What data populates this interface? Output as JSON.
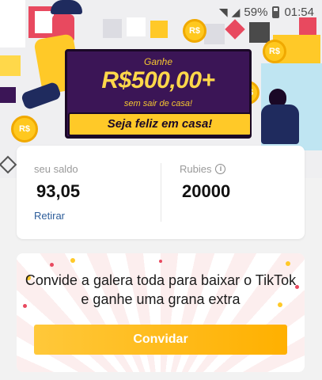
{
  "status_bar": {
    "battery": "59%",
    "time": "01:54"
  },
  "hero": {
    "ganhe": "Ganhe",
    "amount": "R$500,00+",
    "subtitle": "sem sair de casa!",
    "ribbon": "Seja feliz em casa!",
    "coin_label": "R$"
  },
  "balance": {
    "label": "seu saldo",
    "value": "93,05",
    "withdraw": "Retirar"
  },
  "rubies": {
    "label": "Rubies",
    "value": "20000",
    "info_symbol": "i"
  },
  "invite": {
    "text": "Convide a galera toda para baixar o TikTok e ganhe uma grana extra",
    "button": "Convidar"
  },
  "colors": {
    "accent": "#ffb000",
    "banner": "#3b1556",
    "ribbon": "#ffc928",
    "link": "#2d5d9a"
  }
}
